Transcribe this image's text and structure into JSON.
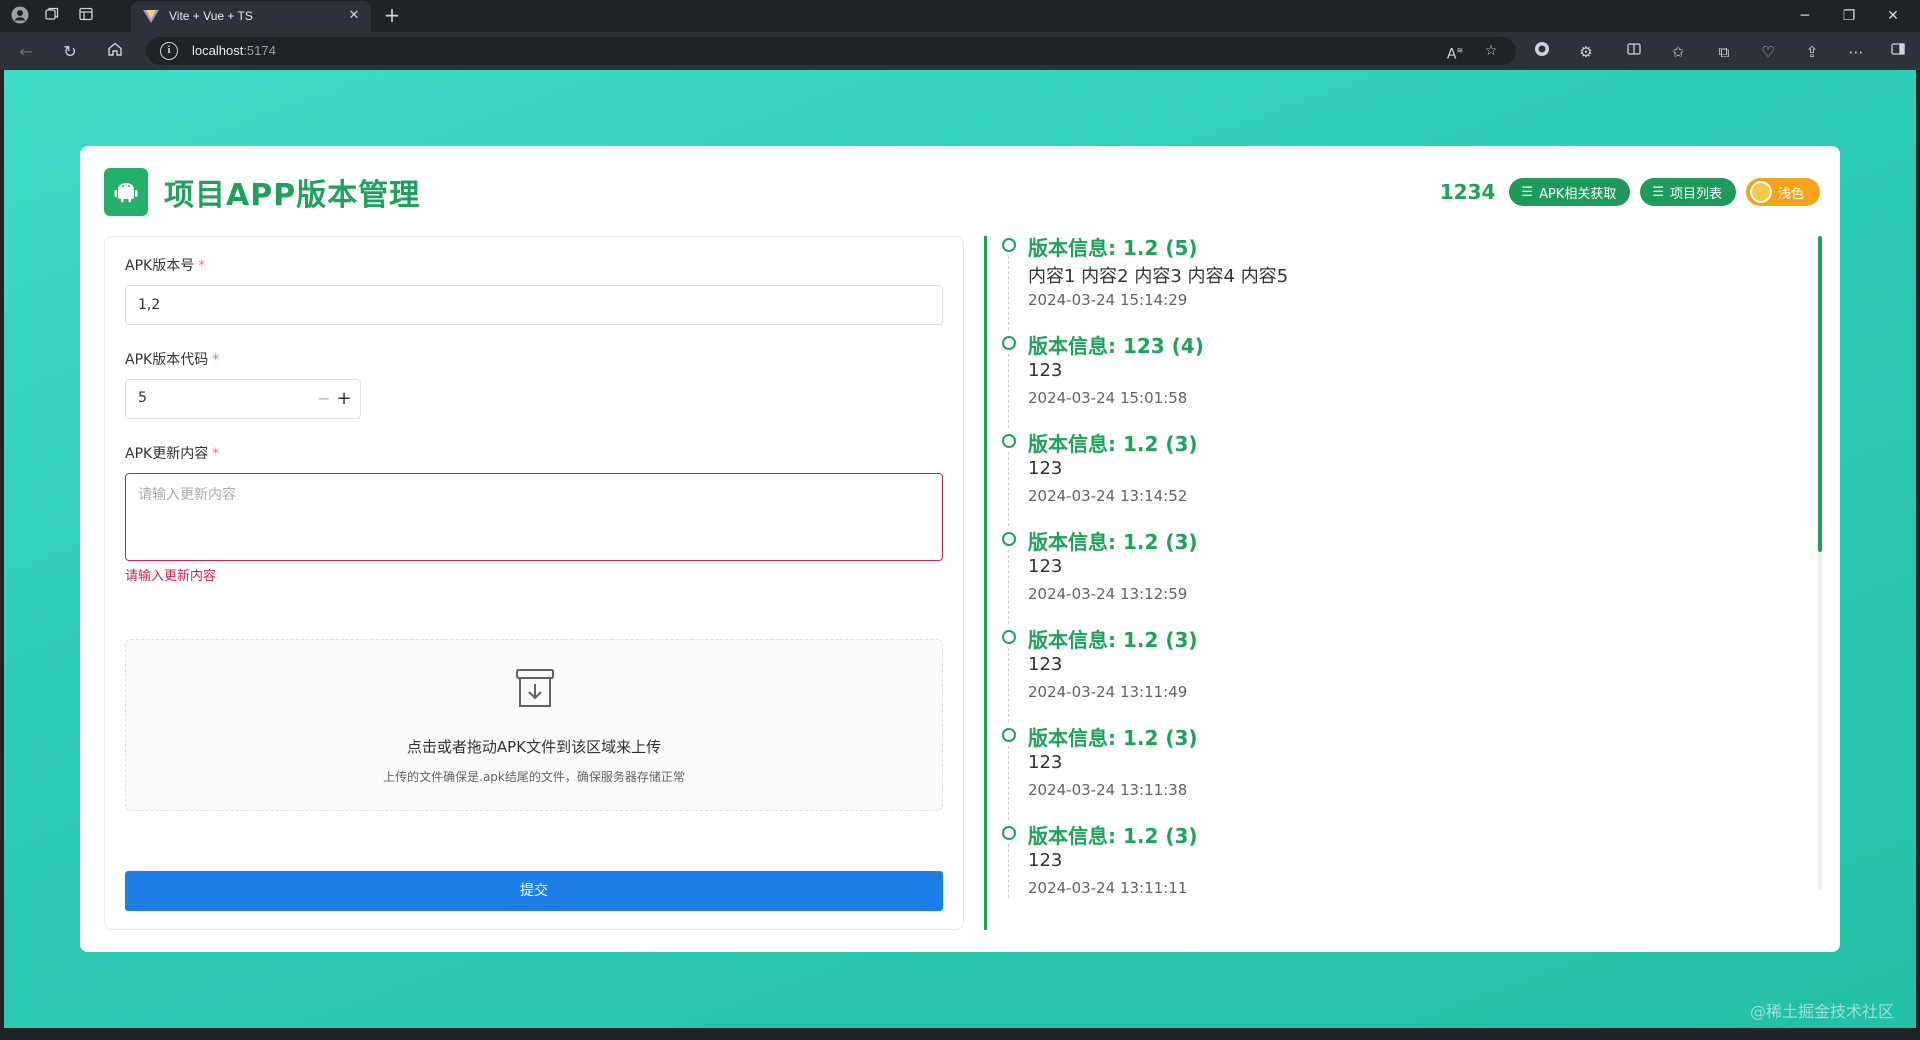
{
  "browser": {
    "tab_title": "Vite + Vue + TS",
    "url_host": "localhost",
    "url_port": ":5174"
  },
  "header": {
    "title": "项目APP版本管理",
    "username": "1234",
    "btn_apk": "APK相关获取",
    "btn_projects": "项目列表",
    "theme_label": "浅色"
  },
  "form": {
    "version_name_label": "APK版本号",
    "version_name_value": "1,2",
    "version_code_label": "APK版本代码",
    "version_code_value": "5",
    "content_label": "APK更新内容",
    "content_placeholder": "请输入更新内容",
    "content_error": "请输入更新内容",
    "upload_main": "点击或者拖动APK文件到该区域来上传",
    "upload_sub": "上传的文件确保是.apk结尾的文件，确保服务器存储正常",
    "submit": "提交",
    "required_mark": "*"
  },
  "versions": [
    {
      "title": "版本信息: 1.2 (5)",
      "content": "内容1 内容2 内容3 内容4 内容5",
      "date": "2024-03-24 15:14:29"
    },
    {
      "title": "版本信息: 123 (4)",
      "content": "123",
      "date": "2024-03-24 15:01:58"
    },
    {
      "title": "版本信息: 1.2 (3)",
      "content": "123",
      "date": "2024-03-24 13:14:52"
    },
    {
      "title": "版本信息: 1.2 (3)",
      "content": "123",
      "date": "2024-03-24 13:12:59"
    },
    {
      "title": "版本信息: 1.2 (3)",
      "content": "123",
      "date": "2024-03-24 13:11:49"
    },
    {
      "title": "版本信息: 1.2 (3)",
      "content": "123",
      "date": "2024-03-24 13:11:38"
    },
    {
      "title": "版本信息: 1.2 (3)",
      "content": "123",
      "date": "2024-03-24 13:11:11"
    }
  ],
  "watermark": "@稀土掘金技术社区",
  "colors": {
    "accent_green": "#1fa05d",
    "primary_blue": "#1e7ee8",
    "error_red": "#c4254b",
    "theme_orange": "#f5a31a"
  }
}
